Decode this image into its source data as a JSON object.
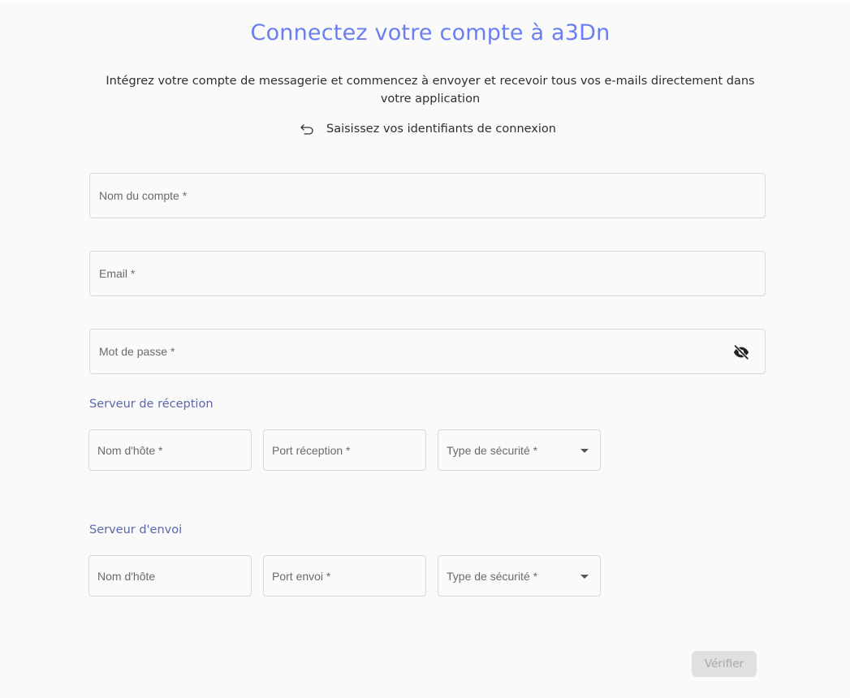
{
  "header": {
    "title": "Connectez votre compte à a3Dn",
    "intro": "Intégrez votre compte de messagerie et commencez à envoyer et recevoir tous vos e-mails directement dans votre application",
    "back_label": "Saisissez vos identifiants de connexion"
  },
  "form": {
    "account_name": {
      "placeholder": "Nom du compte *",
      "value": ""
    },
    "email": {
      "placeholder": "Email *",
      "value": ""
    },
    "password": {
      "placeholder": "Mot de passe *",
      "value": "",
      "visibility_icon": "eye-off-icon"
    }
  },
  "incoming": {
    "section_title": "Serveur de réception",
    "hostname": {
      "placeholder": "Nom d'hôte *"
    },
    "port": {
      "placeholder": "Port réception *"
    },
    "security": {
      "placeholder": "Type de sécurité *",
      "icon": "caret-down-icon"
    }
  },
  "outgoing": {
    "section_title": "Serveur d'envoi",
    "hostname": {
      "placeholder": "Nom d'hôte"
    },
    "port": {
      "placeholder": "Port envoi *"
    },
    "security": {
      "placeholder": "Type de sécurité *",
      "icon": "caret-down-icon"
    }
  },
  "actions": {
    "verify_label": "Vérifier",
    "verify_disabled": true
  },
  "colors": {
    "title": "#6b7ef0",
    "section_title": "#5a67a8",
    "background": "#fafafa",
    "button_disabled_bg": "#e0e0e0"
  }
}
